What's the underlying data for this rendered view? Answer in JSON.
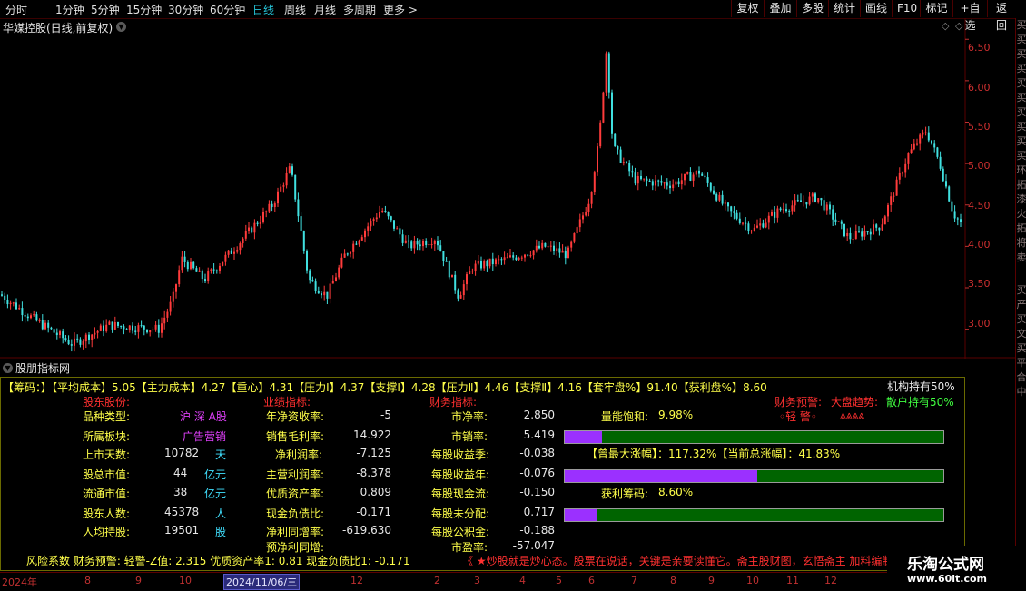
{
  "topbar": {
    "periods": [
      "分时",
      "1分钟",
      "5分钟",
      "15分钟",
      "30分钟",
      "60分钟",
      "日线",
      "周线",
      "月线",
      "多周期",
      "更多"
    ],
    "active_period": "日线",
    "more_arrow": ">",
    "tools": [
      "复权",
      "叠加",
      "多股",
      "统计",
      "画线",
      "F10",
      "标记",
      "+自选",
      "返回"
    ]
  },
  "chart": {
    "title": "华媒控股(日线,前复权)",
    "price_labels": [
      "6.50",
      "6.00",
      "5.50",
      "5.00",
      "4.50",
      "4.00",
      "3.50",
      "3.00"
    ],
    "y_range": [
      2.7,
      6.7
    ]
  },
  "right_strip": {
    "chars": [
      "买",
      "买",
      "买",
      "买",
      "买",
      "买",
      "买",
      "买",
      "买",
      "买",
      "环",
      "拓",
      "漆",
      "火",
      "拓",
      "将",
      "卖"
    ],
    "lower_chars": [
      "买",
      "产",
      "买",
      "文",
      "买",
      "平",
      "合",
      "中"
    ]
  },
  "indicator": {
    "title": "股朋指标网",
    "header_line": "【筹码：】【平均成本】5.05【主力成本】4.27【重心】4.31【压力Ⅰ】4.37【支撑Ⅰ】4.28【压力Ⅱ】4.46【支撑Ⅱ】4.16【套牢盘%】91.40【获利盘%】8.60",
    "jigou": "机构持有50%",
    "sanhu": "散户持有50%",
    "sections": {
      "gudong": "股东股份:",
      "yeji": "业绩指标:",
      "caiwu": "财务指标:"
    },
    "warning_label": "财务预警:",
    "warning_value": "◦轻 警◦",
    "trend_label": "大盘趋势:",
    "trend_value": "⩓⩓⩓⩓",
    "gudong_rows": [
      {
        "label": "品种类型:",
        "value": "沪 深 A股",
        "unit": ""
      },
      {
        "label": "所属板块:",
        "value": "广告营销",
        "unit": ""
      },
      {
        "label": "上市天数:",
        "value": "10782",
        "unit": "天"
      },
      {
        "label": "股总市值:",
        "value": "44",
        "unit": "亿元"
      },
      {
        "label": "流通市值:",
        "value": "38",
        "unit": "亿元"
      },
      {
        "label": "股东人数:",
        "value": "45378",
        "unit": "人"
      },
      {
        "label": "人均持股:",
        "value": "19501",
        "unit": "股"
      }
    ],
    "yeji_rows": [
      {
        "label": "年净资收率:",
        "value": "-5"
      },
      {
        "label": "销售毛利率:",
        "value": "14.922"
      },
      {
        "label": "净利润率:",
        "value": "-7.125"
      },
      {
        "label": "主营利润率:",
        "value": "-8.378"
      },
      {
        "label": "优质资产率:",
        "value": "0.809"
      },
      {
        "label": "现金负债比:",
        "value": "-0.171"
      },
      {
        "label": "净利同增率:",
        "value": "-619.630"
      },
      {
        "label": "预净利同增:",
        "value": ""
      }
    ],
    "caiwu_rows": [
      {
        "label": "市净率:",
        "value": "2.850"
      },
      {
        "label": "市销率:",
        "value": "5.419"
      },
      {
        "label": "每股收益季:",
        "value": "-0.038"
      },
      {
        "label": "每股收益年:",
        "value": "-0.076"
      },
      {
        "label": "每股现金流:",
        "value": "-0.150"
      },
      {
        "label": "每股未分配:",
        "value": "0.717"
      },
      {
        "label": "每股公积金:",
        "value": "-0.188"
      },
      {
        "label": "市盈率:",
        "value": "-57.047"
      }
    ],
    "liangneng_label": "量能饱和:",
    "liangneng_value": "9.98%",
    "zhangfu_line": "【曾最大涨幅】：117.32%【当前总涨幅】：41.83%",
    "huoli_label": "获利筹码:",
    "huoli_value": "8.60%",
    "bars": [
      0.098,
      0.508,
      0.086
    ],
    "risk_line": "风险系数 财务预警: 轻警-Z值: 2.315 优质资产率1: 0.81 现金负债比1: -0.171",
    "marquee": "《 ★炒股就是炒心态。股票在说话，关键是亲要读懂它。斋主股财图，玄悟斋主 加料编制★"
  },
  "bottom": {
    "year": "2024年",
    "months": [
      "8",
      "9",
      "10",
      "12",
      "2",
      "3",
      "4",
      "5",
      "6",
      "7",
      "8",
      "9",
      "10",
      "11",
      "12"
    ],
    "selected_date": "2024/11/06/三"
  },
  "brand": {
    "name": "乐淘公式网",
    "url": "www.60lt.com"
  },
  "colors": {
    "up": "#ff3b3b",
    "down": "#40e0e0",
    "grid": "#5a0000",
    "panel_border": "#6a6a00",
    "purple": "#9b30ff",
    "green": "#006400"
  }
}
